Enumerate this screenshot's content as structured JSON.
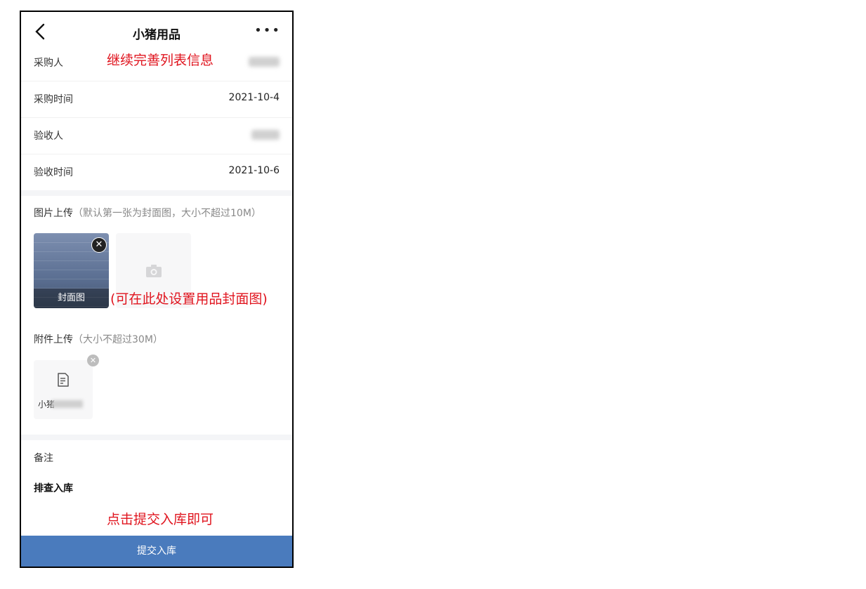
{
  "header": {
    "title": "小猪用品",
    "back_icon": "chevron-left-icon",
    "more_label": "•••"
  },
  "annotations": {
    "top": "继续完善列表信息",
    "cover": "(可在此处设置用品封面图)",
    "bottom": "点击提交入库即可"
  },
  "fields": {
    "purchaser_label": "采购人",
    "purchase_time_label": "采购时间",
    "purchase_time_value": "2021-10-4",
    "inspector_label": "验收人",
    "inspection_time_label": "验收时间",
    "inspection_time_value": "2021-10-6"
  },
  "image_upload": {
    "title": "图片上传",
    "hint": "（默认第一张为封面图，大小不超过10M）",
    "cover_caption": "封面图",
    "delete_icon": "close-circle-icon",
    "add_icon": "camera-icon"
  },
  "attachment_upload": {
    "title": "附件上传",
    "hint": "（大小不超过30M）",
    "file_name_visible": "小猪",
    "file_icon": "document-icon",
    "delete_icon": "close-circle-icon"
  },
  "remarks": {
    "label": "备注",
    "value": "排查入库"
  },
  "submit_button": "提交入库",
  "colors": {
    "accent": "#4a7bbd",
    "annotation": "#e0141e"
  }
}
